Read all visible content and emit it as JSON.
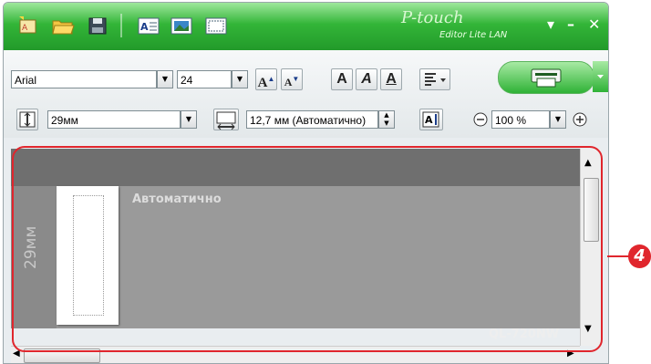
{
  "titlebar": {
    "logo": "P-touch",
    "logo_sub": "Editor Lite LAN"
  },
  "window_controls": {
    "dropdown": "▾",
    "minimize": "–",
    "close": "✕"
  },
  "toolbar": {
    "font_name": "Arial",
    "font_size": "24",
    "tape_width": "29мм",
    "length": "12,7 мм (Автоматично)",
    "zoom": "100 %",
    "grow_font_label": "A",
    "shrink_font_label": "A",
    "bold_label": "A",
    "italic_label": "A",
    "underline_label": "A"
  },
  "canvas": {
    "auto_label": "Автоматично",
    "tape_width_label": "29мм",
    "printer_model": "QL-720NW"
  },
  "callout": {
    "number": "4"
  },
  "colors": {
    "accent": "#33b538",
    "callout": "#e0262d"
  }
}
